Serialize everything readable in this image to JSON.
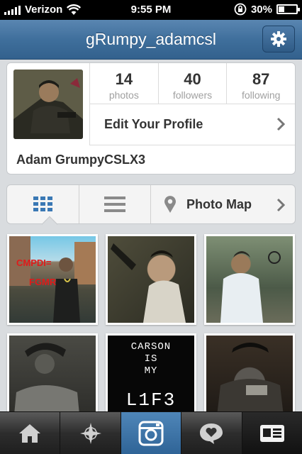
{
  "status": {
    "carrier": "Verizon",
    "time": "9:55 PM",
    "battery": "30%",
    "battery_level": 0.3
  },
  "navbar": {
    "title": "gRumpy_adamcsl",
    "settings_icon": "gear-icon"
  },
  "profile": {
    "stats": [
      {
        "value": "14",
        "label": "photos"
      },
      {
        "value": "40",
        "label": "followers"
      },
      {
        "value": "87",
        "label": "following"
      }
    ],
    "edit_label": "Edit Your Profile",
    "full_name": "Adam GrumpyCSLX3"
  },
  "view_switch": {
    "grid_icon": "grid-icon",
    "list_icon": "list-icon",
    "map_icon": "map-pin-icon",
    "map_label": "Photo Map"
  },
  "photos": [
    {
      "id": "photo-1"
    },
    {
      "id": "photo-2"
    },
    {
      "id": "photo-3"
    },
    {
      "id": "photo-4"
    },
    {
      "id": "photo-5",
      "lines": [
        "CARSON",
        "IS",
        "MY"
      ],
      "big": "L1F3"
    },
    {
      "id": "photo-6"
    }
  ],
  "tabbar": {
    "items": [
      "home-icon",
      "explore-icon",
      "camera-icon",
      "activity-icon",
      "profile-icon"
    ],
    "active_index": 2
  },
  "colors": {
    "nav_blue": "#3f6f9c",
    "active_tab": "#2f6497",
    "grid_icon_blue": "#3a78b4"
  }
}
